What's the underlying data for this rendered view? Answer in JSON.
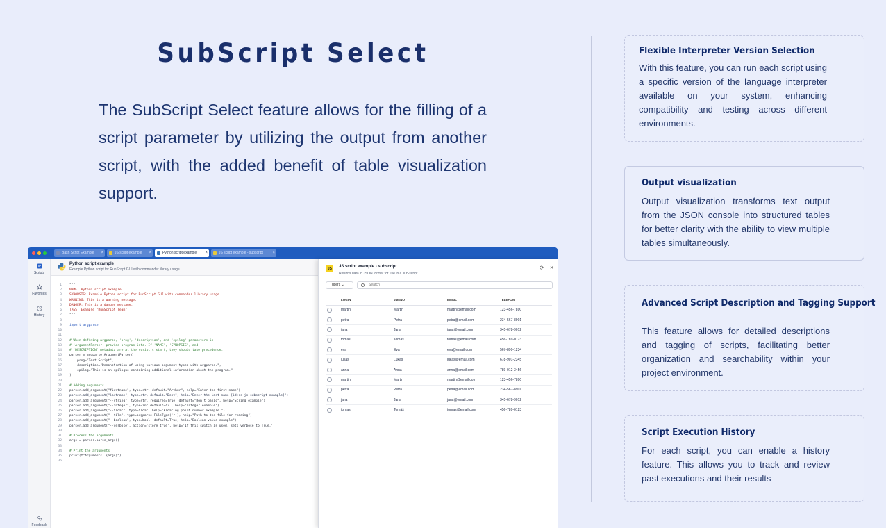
{
  "headline": "SubScript Select",
  "intro": "The SubScript Select feature allows for the filling of a script parameter by utilizing the output from another script, with the added benefit of table visualization support.",
  "cards": [
    {
      "title": "Flexible Interpreter Version Selection",
      "text": "With this feature, you can run each script using a specific version of the language interpreter available on your system, enhancing compatibility and testing across different environments."
    },
    {
      "title": "Output visualization",
      "text": "Output visualization transforms text output from the JSON console into structured tables for better clarity with the ability to view multiple tables simultaneously."
    },
    {
      "title": "Advanced Script Description and Tagging Support",
      "text": "This feature allows for detailed descriptions and tagging of scripts, facilitating better organization and searchability within your project environment."
    },
    {
      "title": "Script Execution History",
      "text": "For each script, you can enable a history feature. This allows you to track and review past executions and their results"
    }
  ],
  "app": {
    "tabs": [
      "Bash Script Example",
      "JS script example",
      "Python script example",
      "JS script example - subscript"
    ],
    "sidebar": {
      "scripts": "Scripts",
      "favorites": "Favorites",
      "history": "History",
      "feedback": "Feedback"
    },
    "editor": {
      "title": "Python script example",
      "subtitle": "Example Python script for RunScript GUI with commander library usage",
      "lines": [
        "\"\"\"",
        "NAME: Python script example",
        "SYNOPSIS: Example Python script for RunScript GUI with commander library usage",
        "WARNING: This is a warning message.",
        "DANGER: This is a danger message.",
        "TAGS: Example \"RunScript Team\"",
        "\"\"\"",
        "",
        "import argparse",
        "",
        "",
        "# When defining argparse, 'prog', 'description', and 'epilog' parameters in",
        "# 'ArgumentParser' provide program info. If 'NAME', 'SYNOPSIS', and",
        "# 'DESCRIPTION' metadata are at the script's start, they should take precedence.",
        "parser = argparse.ArgumentParser(",
        "    prog=\"Test Script\",",
        "    description=\"Demonstration of using various argument types with argparse.\",",
        "    epilog=\"This is an epilogue containing additional information about the program.\"",
        ")",
        "",
        "# Adding arguments",
        "parser.add_argument(\"firstname\", type=str, default=\"Arthur\", help=\"Enter the first name\")",
        "parser.add_argument(\"lastname\", type=str, default=\"Dent\", help=\"Enter the last name [id:rs-js-subscript-example]\")",
        "parser.add_argument(\"--string\", type=str, required=True, default=\"Don't panic\", help=\"String example\")",
        "parser.add_argument(\"--integer\", type=int,default=42 , help=\"Integer example\")",
        "parser.add_argument(\"--float\", type=float, help=\"Floating point number example.\")",
        "parser.add_argument(\"--file\", type=argparse.FileType('r'), help=\"Path to the file for reading\")",
        "parser.add_argument(\"--boolean\", type=bool, default=True, help=\"Boolean value example\")",
        "parser.add_argument(\"--verbose\", action='store_true', help='If this switch is used, sets verbose to True.')",
        "",
        "# Process the arguments",
        "args = parser.parse_args()",
        "",
        "# Print the arguments",
        "print(f\"Arguments: {args}\")",
        ""
      ]
    },
    "panel": {
      "title": "JS script example - subscript",
      "subtitle": "Returns data in JSON format for use in a sub-script",
      "select_value": "users",
      "search_placeholder": "Search",
      "columns": [
        "LOGIN",
        "JMENO",
        "EMAIL",
        "TELEFON"
      ],
      "rows": [
        [
          "martin",
          "Martin",
          "martin@email.com",
          "123-456-7890"
        ],
        [
          "petra",
          "Petra",
          "petra@email.com",
          "234-567-8901"
        ],
        [
          "jana",
          "Jana",
          "jana@email.com",
          "345-678-9012"
        ],
        [
          "tomas",
          "Tomáš",
          "tomas@email.com",
          "456-789-0123"
        ],
        [
          "eva",
          "Eva",
          "eva@email.com",
          "567-890-1234"
        ],
        [
          "lukas",
          "Lukáš",
          "lukas@email.com",
          "678-901-2345"
        ],
        [
          "anna",
          "Anna",
          "anna@email.com",
          "789-012-3456"
        ],
        [
          "martin",
          "Martin",
          "martin@email.com",
          "123-456-7890"
        ],
        [
          "petra",
          "Petra",
          "petra@email.com",
          "234-567-8901"
        ],
        [
          "jana",
          "Jana",
          "jana@email.com",
          "345-678-9012"
        ],
        [
          "tomas",
          "Tomáš",
          "tomas@email.com",
          "456-789-0123"
        ]
      ]
    }
  }
}
